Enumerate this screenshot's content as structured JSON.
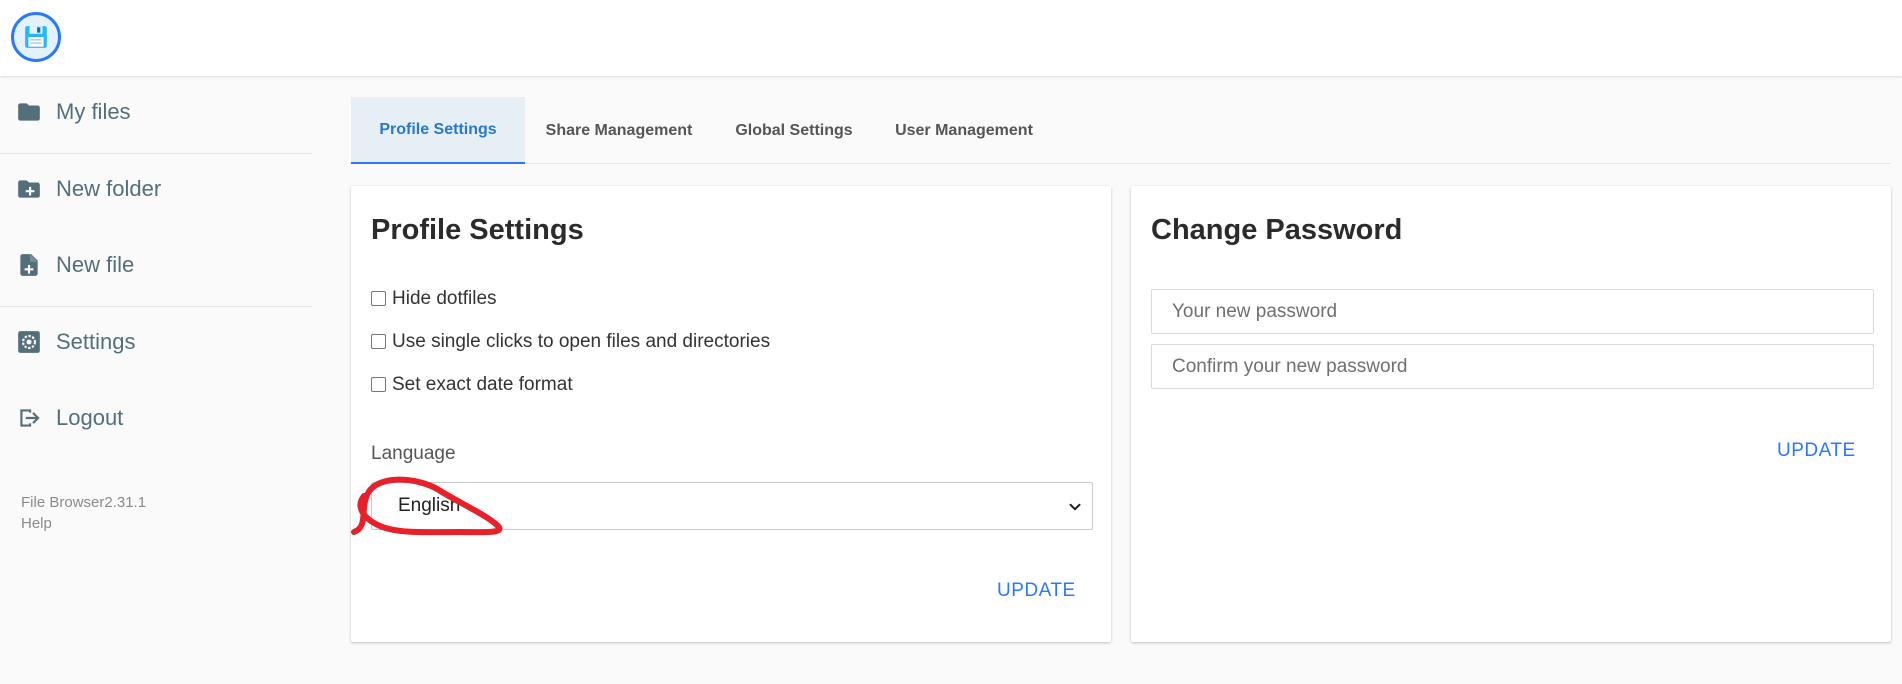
{
  "app": {
    "logo_icon": "floppy-disk-icon",
    "accent_color": "#2979ff"
  },
  "sidebar": {
    "items": [
      {
        "label": "My files",
        "icon": "folder-icon"
      },
      {
        "label": "New folder",
        "icon": "folder-plus-icon"
      },
      {
        "label": "New file",
        "icon": "file-plus-icon"
      },
      {
        "label": "Settings",
        "icon": "settings-gear-icon"
      },
      {
        "label": "Logout",
        "icon": "logout-icon"
      }
    ],
    "credits": {
      "version": "File Browser2.31.1",
      "help": "Help"
    }
  },
  "tabs": [
    {
      "label": "Profile Settings",
      "active": true
    },
    {
      "label": "Share Management",
      "active": false
    },
    {
      "label": "Global Settings",
      "active": false
    },
    {
      "label": "User Management",
      "active": false
    }
  ],
  "profile": {
    "title": "Profile Settings",
    "checkboxes": [
      {
        "label": "Hide dotfiles",
        "checked": false
      },
      {
        "label": "Use single clicks to open files and directories",
        "checked": false
      },
      {
        "label": "Set exact date format",
        "checked": false
      }
    ],
    "language_label": "Language",
    "language_selected": "English",
    "update_label": "UPDATE"
  },
  "password": {
    "title": "Change Password",
    "new_placeholder": "Your new password",
    "confirm_placeholder": "Confirm your new password",
    "update_label": "UPDATE"
  },
  "annotation_color": "#e8202a"
}
